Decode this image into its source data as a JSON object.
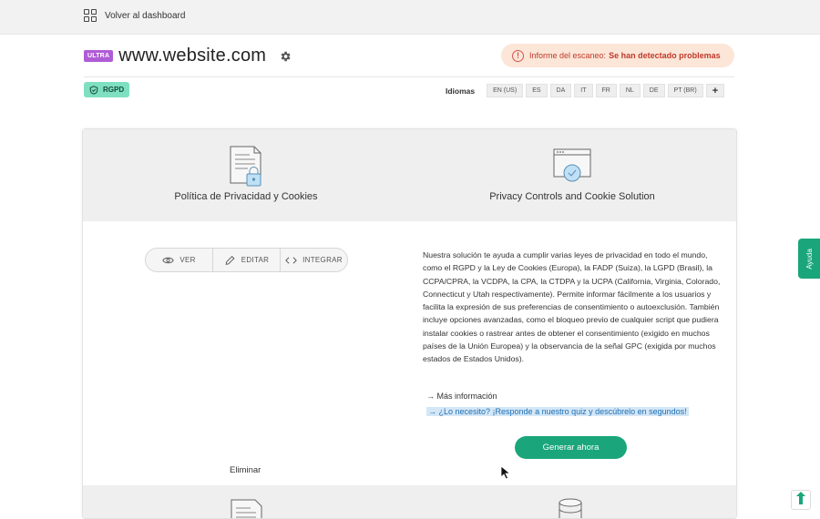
{
  "topbar": {
    "back_label": "Volver al dashboard",
    "icon": "dashboard-grid-icon"
  },
  "site": {
    "badge": "ULTRA",
    "title": "www.website.com",
    "settings_icon": "gear-icon"
  },
  "scan": {
    "label": "Informe del escaneo:",
    "status": "Se han detectado problemas",
    "icon": "warning-circle-icon"
  },
  "compliance": {
    "badge": "RGPD",
    "icon": "shield-check-icon"
  },
  "languages": {
    "label": "Idiomas",
    "items": [
      "EN (US)",
      "ES",
      "DA",
      "IT",
      "FR",
      "NL",
      "DE",
      "PT (BR)"
    ],
    "add_label": "+"
  },
  "products": [
    {
      "title": "Política de Privacidad y Cookies",
      "icon": "document-lock-icon"
    },
    {
      "title": "Privacy Controls and Cookie Solution",
      "icon": "browser-cookie-icon"
    }
  ],
  "actions": {
    "view": "VER",
    "edit": "EDITAR",
    "embed": "INTEGRAR"
  },
  "delete_label": "Eliminar",
  "description": "Nuestra solución te ayuda a cumplir varias leyes de privacidad en todo el mundo, como el RGPD y la Ley de Cookies (Europa), la FADP (Suiza), la LGPD (Brasil), la CCPA/CPRA, la VCDPA, la CPA, la CTDPA y la UCPA (California, Virginia, Colorado, Connecticut y Utah respectivamente). Permite informar fácilmente a los usuarios y facilita la expresión de sus preferencias de consentimiento o autoexclusión. También incluye opciones avanzadas, como el bloqueo previo de cualquier script que pudiera instalar cookies o rastrear antes de obtener el consentimiento (exigido en muchos países de la Unión Europea) y la observancia de la señal GPC (exigida por muchos estados de Estados Unidos).",
  "links": {
    "more": "→ Más información",
    "quiz": "→ ¿Lo necesito? ¡Responde a nuestro quiz y descúbrelo en segundos!"
  },
  "generate_label": "Generar ahora",
  "help_label": "Ayuda",
  "colors": {
    "accent": "#1aa67a",
    "ultra": "#b05bd6",
    "rgpd": "#7ee0c0",
    "scan_bg": "#fbe6d8",
    "scan_text": "#c0392b"
  }
}
